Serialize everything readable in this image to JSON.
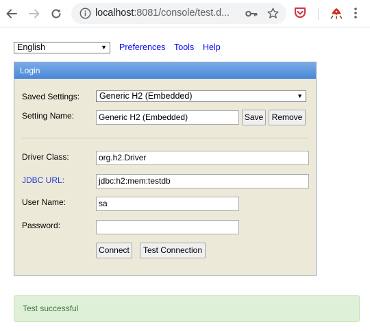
{
  "browser": {
    "url_host": "localhost",
    "url_rest": ":8081/console/test.d..."
  },
  "topbar": {
    "language": "English",
    "links": [
      "Preferences",
      "Tools",
      "Help"
    ]
  },
  "login": {
    "title": "Login",
    "saved_settings_label": "Saved Settings:",
    "saved_settings_value": "Generic H2 (Embedded)",
    "setting_name_label": "Setting Name:",
    "setting_name_value": "Generic H2 (Embedded)",
    "save_label": "Save",
    "remove_label": "Remove",
    "driver_class_label": "Driver Class:",
    "driver_class_value": "org.h2.Driver",
    "jdbc_url_label": "JDBC URL:",
    "jdbc_url_value": "jdbc:h2:mem:testdb",
    "user_name_label": "User Name:",
    "user_name_value": "sa",
    "password_label": "Password:",
    "password_value": "",
    "connect_label": "Connect",
    "test_connection_label": "Test Connection"
  },
  "status": {
    "message": "Test successful"
  },
  "colors": {
    "panel_bg": "#ece9d8",
    "header_blue": "#4a87d8",
    "link_blue": "#0000ee",
    "success_bg": "#dff0d8",
    "success_text": "#3c763d"
  },
  "icons": [
    "back-icon",
    "forward-icon",
    "reload-icon",
    "info-icon",
    "key-icon",
    "star-icon",
    "pocket-icon",
    "bug-extension-icon",
    "menu-icon"
  ]
}
